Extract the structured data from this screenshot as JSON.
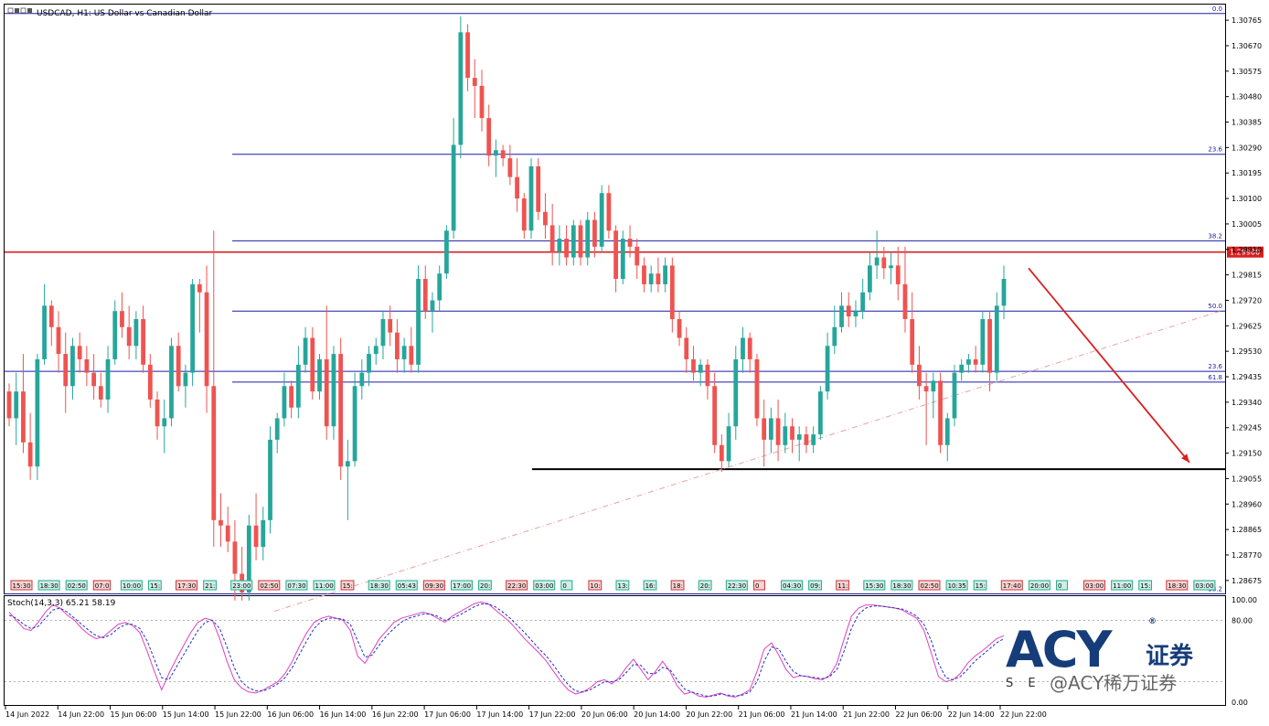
{
  "header": {
    "title": "USDCAD, H1:  US Dollar vs Canadian Dollar"
  },
  "logo": {
    "brand": "ACY",
    "suffix": "证券",
    "tagline": "S E",
    "registered": "®"
  },
  "watermark": "@ACY稀万证券",
  "chart_data": {
    "type": "candlestick",
    "symbol": "USDCAD",
    "timeframe": "H1",
    "ylim": [
      1.2863,
      1.3082
    ],
    "price_ticks": [
      1.30765,
      1.3067,
      1.30575,
      1.3048,
      1.30385,
      1.3029,
      1.30195,
      1.301,
      1.30005,
      1.2991,
      1.29815,
      1.2972,
      1.29625,
      1.2953,
      1.29435,
      1.2934,
      1.29245,
      1.2915,
      1.29055,
      1.2896,
      1.28865,
      1.2877,
      1.28675
    ],
    "price_tick_labels": [
      "1.30765",
      "1.30670",
      "1.30575",
      "1.30480",
      "1.30385",
      "1.30290",
      "1.30195",
      "1.30100",
      "1.30005",
      "1.29910",
      "1.29815",
      "1.29720",
      "1.29625",
      "1.29530",
      "1.29435",
      "1.29340",
      "1.29245",
      "1.29150",
      "1.29055",
      "1.28960",
      "1.28865",
      "1.28770",
      "1.28675"
    ],
    "x_labels": [
      "14 Jun 2022",
      "14 Jun 22:00",
      "15 Jun 06:00",
      "15 Jun 14:00",
      "15 Jun 22:00",
      "16 Jun 06:00",
      "16 Jun 14:00",
      "16 Jun 22:00",
      "17 Jun 06:00",
      "17 Jun 14:00",
      "17 Jun 22:00",
      "20 Jun 06:00",
      "20 Jun 14:00",
      "20 Jun 22:00",
      "21 Jun 06:00",
      "21 Jun 14:00",
      "21 Jun 22:00",
      "22 Jun 06:00",
      "22 Jun 14:00",
      "22 Jun 22:00"
    ],
    "session_badges": [
      "15:30",
      "18:30",
      "02:50",
      "07:0",
      "10:00",
      "15:",
      "17:30",
      "21:",
      "23:00",
      "02:50",
      "07:30",
      "11:00",
      "15:",
      "18:30",
      "05:43",
      "09:30",
      "17:00",
      "20:",
      "22:30",
      "03:00",
      "0",
      "10:",
      "13:",
      "16:",
      "18:",
      "20:",
      "22:30",
      "0",
      "04:30",
      "09:",
      "11:",
      "15:30",
      "18:30",
      "02:50",
      "10:35",
      "15:",
      "17:40",
      "20:00",
      "0",
      "03:00",
      "11:00",
      "15:",
      "18:30",
      "03:00"
    ],
    "candles": [
      [
        1.2938,
        1.2941,
        1.2925,
        1.2928
      ],
      [
        1.2928,
        1.2945,
        1.2918,
        1.2938
      ],
      [
        1.2938,
        1.2952,
        1.2915,
        1.2919
      ],
      [
        1.2919,
        1.293,
        1.2905,
        1.291
      ],
      [
        1.291,
        1.2952,
        1.2905,
        1.295
      ],
      [
        1.295,
        1.2978,
        1.2948,
        1.297
      ],
      [
        1.297,
        1.2972,
        1.2955,
        1.2962
      ],
      [
        1.2962,
        1.2968,
        1.2945,
        1.2952
      ],
      [
        1.2952,
        1.296,
        1.293,
        1.294
      ],
      [
        1.294,
        1.2958,
        1.2935,
        1.2955
      ],
      [
        1.2955,
        1.296,
        1.2945,
        1.295
      ],
      [
        1.295,
        1.2955,
        1.294,
        1.2945
      ],
      [
        1.2945,
        1.2952,
        1.2935,
        1.294
      ],
      [
        1.294,
        1.2945,
        1.2932,
        1.2935
      ],
      [
        1.2935,
        1.2955,
        1.293,
        1.295
      ],
      [
        1.295,
        1.2972,
        1.2948,
        1.2968
      ],
      [
        1.2968,
        1.2975,
        1.2958,
        1.2962
      ],
      [
        1.2962,
        1.297,
        1.295,
        1.2955
      ],
      [
        1.2955,
        1.2968,
        1.295,
        1.2965
      ],
      [
        1.2965,
        1.297,
        1.2945,
        1.2948
      ],
      [
        1.2948,
        1.2952,
        1.2932,
        1.2935
      ],
      [
        1.2935,
        1.2938,
        1.292,
        1.2925
      ],
      [
        1.2925,
        1.2935,
        1.2915,
        1.2928
      ],
      [
        1.2928,
        1.2958,
        1.2925,
        1.2955
      ],
      [
        1.2955,
        1.296,
        1.2938,
        1.294
      ],
      [
        1.294,
        1.2948,
        1.2932,
        1.2945
      ],
      [
        1.2945,
        1.298,
        1.294,
        1.2978
      ],
      [
        1.2978,
        1.298,
        1.296,
        1.2975
      ],
      [
        1.2975,
        1.2985,
        1.293,
        1.294
      ],
      [
        1.294,
        1.2998,
        1.288,
        1.289
      ],
      [
        1.289,
        1.29,
        1.288,
        1.2888
      ],
      [
        1.2888,
        1.2895,
        1.2878,
        1.2882
      ],
      [
        1.2882,
        1.289,
        1.286,
        1.287
      ],
      [
        1.287,
        1.288,
        1.286,
        1.2863
      ],
      [
        1.2863,
        1.2892,
        1.286,
        1.2888
      ],
      [
        1.2888,
        1.29,
        1.2875,
        1.288
      ],
      [
        1.288,
        1.2895,
        1.2875,
        1.289
      ],
      [
        1.289,
        1.2925,
        1.2885,
        1.292
      ],
      [
        1.292,
        1.293,
        1.2915,
        1.2928
      ],
      [
        1.2928,
        1.2945,
        1.2925,
        1.294
      ],
      [
        1.294,
        1.2942,
        1.2928,
        1.2932
      ],
      [
        1.2932,
        1.2955,
        1.2928,
        1.2948
      ],
      [
        1.2948,
        1.2962,
        1.2945,
        1.2958
      ],
      [
        1.2958,
        1.2962,
        1.2935,
        1.2938
      ],
      [
        1.2938,
        1.2952,
        1.2935,
        1.295
      ],
      [
        1.295,
        1.297,
        1.292,
        1.2925
      ],
      [
        1.2925,
        1.2955,
        1.292,
        1.2952
      ],
      [
        1.2952,
        1.2958,
        1.2905,
        1.291
      ],
      [
        1.291,
        1.292,
        1.289,
        1.2912
      ],
      [
        1.2912,
        1.2945,
        1.291,
        1.294
      ],
      [
        1.294,
        1.295,
        1.2935,
        1.2945
      ],
      [
        1.2945,
        1.2955,
        1.294,
        1.2952
      ],
      [
        1.2952,
        1.2958,
        1.2948,
        1.2955
      ],
      [
        1.2955,
        1.2968,
        1.295,
        1.2965
      ],
      [
        1.2965,
        1.297,
        1.2955,
        1.296
      ],
      [
        1.296,
        1.2965,
        1.2945,
        1.295
      ],
      [
        1.295,
        1.2958,
        1.2945,
        1.2955
      ],
      [
        1.2955,
        1.2962,
        1.2945,
        1.2948
      ],
      [
        1.2948,
        1.2985,
        1.2945,
        1.298
      ],
      [
        1.298,
        1.2985,
        1.2965,
        1.2968
      ],
      [
        1.2968,
        1.2975,
        1.296,
        1.2972
      ],
      [
        1.2972,
        1.2985,
        1.2968,
        1.2982
      ],
      [
        1.2982,
        1.3,
        1.298,
        1.2998
      ],
      [
        1.2998,
        1.304,
        1.2995,
        1.303
      ],
      [
        1.303,
        1.3078,
        1.3025,
        1.3072
      ],
      [
        1.3072,
        1.3075,
        1.305,
        1.3055
      ],
      [
        1.3055,
        1.3062,
        1.304,
        1.3052
      ],
      [
        1.3052,
        1.3058,
        1.3035,
        1.304
      ],
      [
        1.304,
        1.3045,
        1.3022,
        1.3026
      ],
      [
        1.3026,
        1.3032,
        1.3018,
        1.3028
      ],
      [
        1.3028,
        1.303,
        1.3022,
        1.3025
      ],
      [
        1.3025,
        1.303,
        1.3015,
        1.3018
      ],
      [
        1.3018,
        1.3025,
        1.3005,
        1.301
      ],
      [
        1.301,
        1.3012,
        1.2995,
        1.2998
      ],
      [
        1.2998,
        1.3025,
        1.2995,
        1.3022
      ],
      [
        1.3022,
        1.3025,
        1.3002,
        1.3005
      ],
      [
        1.3005,
        1.3012,
        1.2995,
        1.3
      ],
      [
        1.3,
        1.3008,
        1.2985,
        1.299
      ],
      [
        1.299,
        1.3,
        1.2985,
        1.2995
      ],
      [
        1.2995,
        1.3,
        1.2985,
        1.2988
      ],
      [
        1.2988,
        1.3002,
        1.2985,
        1.3
      ],
      [
        1.3,
        1.3002,
        1.2985,
        1.2988
      ],
      [
        1.2988,
        1.3005,
        1.2985,
        1.3002
      ],
      [
        1.3002,
        1.3005,
        1.2988,
        1.2992
      ],
      [
        1.2992,
        1.3015,
        1.299,
        1.3012
      ],
      [
        1.3012,
        1.3015,
        1.2995,
        1.2998
      ],
      [
        1.2998,
        1.3,
        1.2975,
        1.298
      ],
      [
        1.298,
        1.2998,
        1.2978,
        1.2995
      ],
      [
        1.2995,
        1.3,
        1.2988,
        1.2992
      ],
      [
        1.2992,
        1.2995,
        1.298,
        1.2985
      ],
      [
        1.2985,
        1.2988,
        1.2975,
        1.2978
      ],
      [
        1.2978,
        1.2985,
        1.2975,
        1.2982
      ],
      [
        1.2982,
        1.2988,
        1.2975,
        1.2978
      ],
      [
        1.2978,
        1.2988,
        1.2975,
        1.2985
      ],
      [
        1.2985,
        1.2988,
        1.296,
        1.2965
      ],
      [
        1.2965,
        1.2968,
        1.2955,
        1.2958
      ],
      [
        1.2958,
        1.2962,
        1.2945,
        1.295
      ],
      [
        1.295,
        1.2955,
        1.2942,
        1.2945
      ],
      [
        1.2945,
        1.295,
        1.294,
        1.2948
      ],
      [
        1.2948,
        1.295,
        1.2935,
        1.294
      ],
      [
        1.294,
        1.2945,
        1.2915,
        1.2918
      ],
      [
        1.2918,
        1.2922,
        1.2908,
        1.2912
      ],
      [
        1.2912,
        1.293,
        1.291,
        1.2925
      ],
      [
        1.2925,
        1.2955,
        1.292,
        1.295
      ],
      [
        1.295,
        1.2962,
        1.2945,
        1.2958
      ],
      [
        1.2958,
        1.296,
        1.2945,
        1.295
      ],
      [
        1.295,
        1.2952,
        1.2925,
        1.2928
      ],
      [
        1.2928,
        1.2935,
        1.291,
        1.292
      ],
      [
        1.292,
        1.2932,
        1.2915,
        1.2928
      ],
      [
        1.2928,
        1.2935,
        1.2912,
        1.2918
      ],
      [
        1.2918,
        1.293,
        1.2915,
        1.2925
      ],
      [
        1.2925,
        1.2928,
        1.2915,
        1.292
      ],
      [
        1.292,
        1.2925,
        1.2912,
        1.2922
      ],
      [
        1.2922,
        1.2925,
        1.2915,
        1.2918
      ],
      [
        1.2918,
        1.2925,
        1.2915,
        1.2922
      ],
      [
        1.2922,
        1.294,
        1.292,
        1.2938
      ],
      [
        1.2938,
        1.296,
        1.2935,
        1.2955
      ],
      [
        1.2955,
        1.297,
        1.2952,
        1.2962
      ],
      [
        1.2962,
        1.2975,
        1.296,
        1.297
      ],
      [
        1.297,
        1.2975,
        1.2962,
        1.2966
      ],
      [
        1.2966,
        1.2972,
        1.2962,
        1.2968
      ],
      [
        1.2968,
        1.298,
        1.2965,
        1.2975
      ],
      [
        1.2975,
        1.299,
        1.2972,
        1.2985
      ],
      [
        1.2985,
        1.2998,
        1.298,
        1.2988
      ],
      [
        1.2988,
        1.2992,
        1.298,
        1.2984
      ],
      [
        1.2984,
        1.299,
        1.2978,
        1.2985
      ],
      [
        1.2985,
        1.2992,
        1.2972,
        1.2978
      ],
      [
        1.2978,
        1.2992,
        1.296,
        1.2965
      ],
      [
        1.2965,
        1.2975,
        1.2945,
        1.2948
      ],
      [
        1.2948,
        1.2955,
        1.2935,
        1.294
      ],
      [
        1.294,
        1.2945,
        1.2918,
        1.2938
      ],
      [
        1.2938,
        1.2945,
        1.2928,
        1.2942
      ],
      [
        1.2942,
        1.2945,
        1.2915,
        1.2918
      ],
      [
        1.2918,
        1.293,
        1.2912,
        1.2928
      ],
      [
        1.2928,
        1.2948,
        1.2925,
        1.2945
      ],
      [
        1.2945,
        1.295,
        1.2942,
        1.2948
      ],
      [
        1.2948,
        1.2952,
        1.2945,
        1.295
      ],
      [
        1.295,
        1.2955,
        1.2945,
        1.2948
      ],
      [
        1.2948,
        1.2968,
        1.2945,
        1.2965
      ],
      [
        1.2965,
        1.2968,
        1.2938,
        1.2945
      ],
      [
        1.2945,
        1.2975,
        1.2942,
        1.297
      ],
      [
        1.297,
        1.2985,
        1.2965,
        1.298
      ]
    ],
    "horizontal_lines": [
      {
        "label": "0.0",
        "value": 1.3079,
        "color": "#1c1caa"
      },
      {
        "label": "23.6",
        "value": 1.30265,
        "color": "#1c1caa"
      },
      {
        "label": "38.2",
        "value": 1.29942,
        "color": "#1c1caa"
      },
      {
        "label": "1.29900",
        "value": 1.299,
        "color": "#d81f1f"
      },
      {
        "label": "50.0",
        "value": 1.2968,
        "color": "#1c1caa"
      },
      {
        "label": "23.6",
        "value": 1.29455,
        "color": "#1c1caa"
      },
      {
        "label": "61.8",
        "value": 1.29415,
        "color": "#1c1caa"
      },
      {
        "label": "38.2",
        "value": 1.28625,
        "color": "#1c1caa"
      }
    ],
    "support_line": {
      "value": 1.2909,
      "color": "#000000"
    },
    "trendline": {
      "from": 1.2856,
      "to": 1.2968,
      "color": "#e8a0a0"
    },
    "forecast_arrow": {
      "from": 1.2984,
      "to": 1.29115,
      "color": "#d81f1f"
    },
    "stochastic": {
      "label": "Stoch(14,3,3) 65.21 58.19",
      "ylim": [
        0,
        100
      ],
      "ticks": [
        100,
        80,
        0
      ],
      "tick_labels": [
        "100.00",
        "80.00",
        "0.00"
      ],
      "levels": [
        80,
        20
      ],
      "main_color": "#e040c0",
      "signal_color": "#2030c0",
      "main": [
        88,
        80,
        72,
        70,
        78,
        88,
        95,
        92,
        85,
        80,
        72,
        66,
        62,
        64,
        70,
        76,
        78,
        75,
        68,
        50,
        30,
        12,
        28,
        42,
        55,
        68,
        78,
        82,
        80,
        62,
        40,
        22,
        14,
        10,
        9,
        12,
        16,
        20,
        28,
        40,
        55,
        68,
        78,
        82,
        84,
        82,
        80,
        70,
        45,
        38,
        50,
        62,
        70,
        78,
        82,
        84,
        86,
        88,
        86,
        82,
        78,
        84,
        88,
        92,
        96,
        98,
        96,
        90,
        84,
        78,
        70,
        62,
        55,
        48,
        40,
        30,
        20,
        12,
        8,
        10,
        14,
        20,
        22,
        18,
        24,
        34,
        42,
        32,
        22,
        30,
        40,
        30,
        16,
        8,
        10,
        6,
        5,
        7,
        9,
        6,
        5,
        8,
        12,
        30,
        52,
        58,
        46,
        32,
        24,
        26,
        25,
        23,
        22,
        26,
        38,
        62,
        84,
        92,
        95,
        95,
        94,
        93,
        92,
        90,
        86,
        82,
        70,
        48,
        25,
        20,
        22,
        28,
        38,
        45,
        50,
        56,
        62,
        65
      ]
    },
    "stochastic_signal": [
      85,
      82,
      76,
      72,
      74,
      82,
      90,
      92,
      88,
      82,
      76,
      70,
      65,
      63,
      66,
      72,
      76,
      76,
      72,
      60,
      42,
      24,
      22,
      34,
      46,
      58,
      70,
      78,
      80,
      72,
      54,
      34,
      20,
      14,
      11,
      11,
      14,
      18,
      24,
      34,
      47,
      60,
      72,
      79,
      82,
      82,
      81,
      76,
      60,
      44,
      46,
      56,
      65,
      72,
      78,
      82,
      84,
      86,
      86,
      84,
      80,
      82,
      85,
      89,
      93,
      96,
      96,
      93,
      88,
      82,
      75,
      68,
      60,
      52,
      45,
      36,
      26,
      17,
      11,
      10,
      12,
      16,
      20,
      20,
      22,
      29,
      37,
      36,
      28,
      28,
      34,
      32,
      22,
      13,
      10,
      8,
      6,
      6,
      8,
      7,
      6,
      7,
      10,
      20,
      40,
      54,
      52,
      40,
      30,
      26,
      25,
      24,
      23,
      25,
      32,
      50,
      72,
      86,
      92,
      94,
      94,
      93,
      92,
      91,
      88,
      84,
      76,
      60,
      38,
      24,
      22,
      25,
      32,
      40,
      46,
      52,
      58,
      62
    ]
  }
}
